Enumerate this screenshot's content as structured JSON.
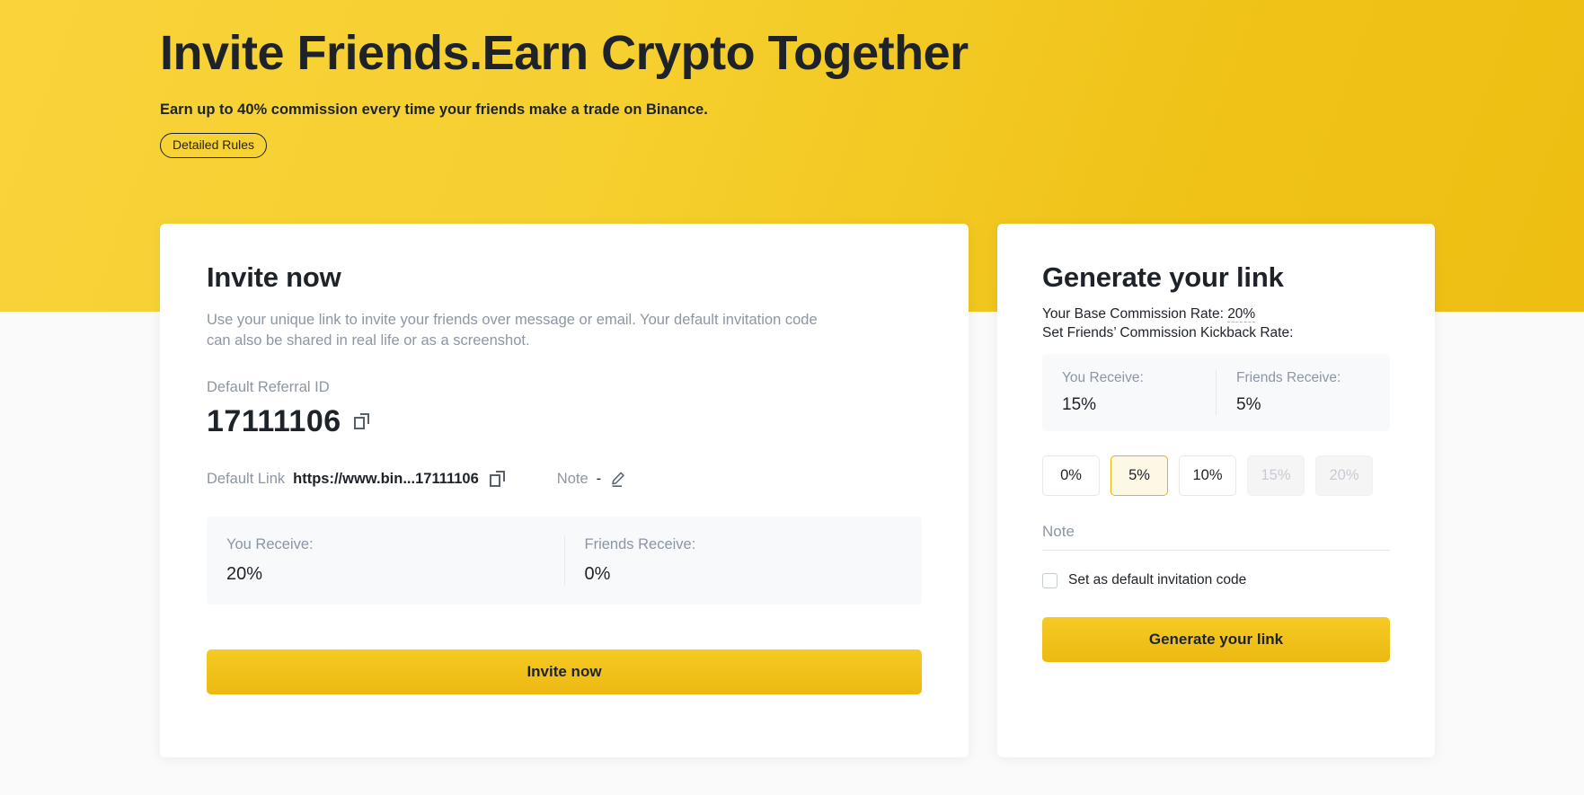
{
  "hero": {
    "title": "Invite Friends.Earn Crypto Together",
    "subtitle": "Earn up to 40% commission every time your friends make a trade on Binance.",
    "detailed_rules_label": "Detailed Rules"
  },
  "invite_card": {
    "title": "Invite now",
    "description": "Use your unique link to invite your friends over message or email. Your default invitation code can also be shared in real life or as a screenshot.",
    "referral_id_label": "Default Referral ID",
    "referral_id_value": "17111106",
    "copy_referral_icon": "copy-icon",
    "default_link_label": "Default Link",
    "default_link_value": "https://www.bin...17111106",
    "copy_link_icon": "copy-icon",
    "note_label": "Note",
    "note_value": "-",
    "edit_note_icon": "pencil-icon",
    "you_receive_label": "You Receive:",
    "you_receive_value": "20%",
    "friends_receive_label": "Friends Receive:",
    "friends_receive_value": "0%",
    "invite_button_label": "Invite now"
  },
  "generate_card": {
    "title": "Generate your link",
    "base_rate_prefix": "Your Base Commission Rate: ",
    "base_rate_value": "20%",
    "kickback_label": "Set Friends’ Commission Kickback Rate:",
    "you_receive_label": "You Receive:",
    "you_receive_value": "15%",
    "friends_receive_label": "Friends Receive:",
    "friends_receive_value": "5%",
    "rate_options": [
      {
        "label": "0%",
        "state": "normal"
      },
      {
        "label": "5%",
        "state": "selected"
      },
      {
        "label": "10%",
        "state": "normal"
      },
      {
        "label": "15%",
        "state": "disabled"
      },
      {
        "label": "20%",
        "state": "disabled"
      }
    ],
    "note_placeholder": "Note",
    "note_value": "",
    "default_code_label": "Set as default invitation code",
    "default_code_checked": false,
    "generate_button_label": "Generate your link"
  },
  "colors": {
    "brand_yellow": "#f0c419",
    "banner_yellow_start": "#f8d33a",
    "banner_yellow_end": "#eebe12",
    "text_dark": "#1e2329",
    "text_muted": "#8d96a3",
    "card_bg": "#ffffff",
    "page_bg": "#fafafa",
    "selected_border": "#eab308",
    "selected_bg": "#fdf8e6",
    "disabled_text": "#c6ccd3"
  }
}
